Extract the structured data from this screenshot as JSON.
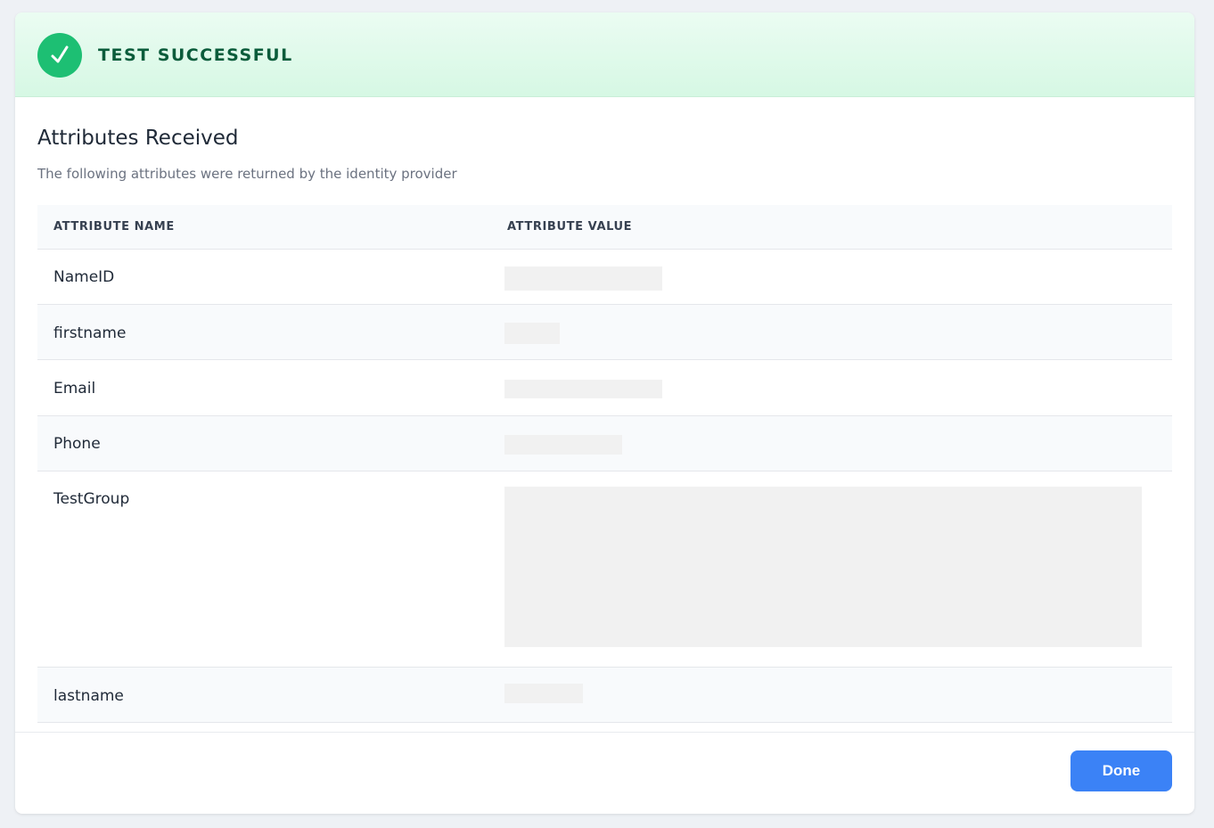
{
  "banner": {
    "title": "TEST SUCCESSFUL",
    "accent_color": "#1dbf73",
    "icon": "check-icon"
  },
  "section": {
    "title": "Attributes Received",
    "subtitle": "The following attributes were returned by the identity provider"
  },
  "table": {
    "headers": {
      "name": "ATTRIBUTE NAME",
      "value": "ATTRIBUTE VALUE"
    },
    "rows": [
      {
        "name": "NameID"
      },
      {
        "name": "firstname"
      },
      {
        "name": "Email"
      },
      {
        "name": "Phone"
      },
      {
        "name": "TestGroup"
      },
      {
        "name": "lastname"
      }
    ]
  },
  "footer": {
    "done_label": "Done",
    "button_color": "#3b82f6"
  }
}
